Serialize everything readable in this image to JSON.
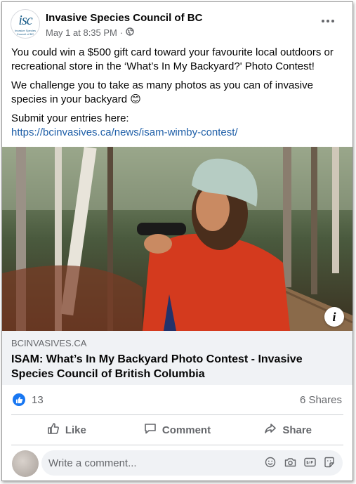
{
  "post": {
    "page_name": "Invasive Species Council of BC",
    "timestamp": "May 1 at 8:35 PM",
    "audience_icon": "globe-icon",
    "logo": {
      "mark": "isc",
      "sub": "Invasive Species Council of BC"
    },
    "paragraphs": [
      "You could win a $500 gift card toward your favourite local outdoors or recreational store in the ‘What’s In My Backyard?' Photo Contest!",
      "We challenge you to take as many photos as you can of invasive species in your backyard 😊",
      "Submit your entries here:"
    ],
    "link_text": "https://bcinvasives.ca/news/isam-wimby-contest/"
  },
  "photo": {
    "info_label": "i"
  },
  "link_preview": {
    "domain": "BCINVASIVES.CA",
    "title": "ISAM: What’s In My Backyard Photo Contest - Invasive Species Council of British Columbia"
  },
  "stats": {
    "reactions": "13",
    "shares": "6 Shares"
  },
  "actions": {
    "like": "Like",
    "comment": "Comment",
    "share": "Share"
  },
  "comment": {
    "placeholder": "Write a comment...",
    "icons": [
      "emoji-icon",
      "camera-icon",
      "gif-icon",
      "sticker-icon"
    ]
  },
  "colors": {
    "link": "#1f5fa8",
    "like_blue": "#1877f2",
    "muted": "#65676b",
    "preview_bg": "#f0f2f5"
  }
}
